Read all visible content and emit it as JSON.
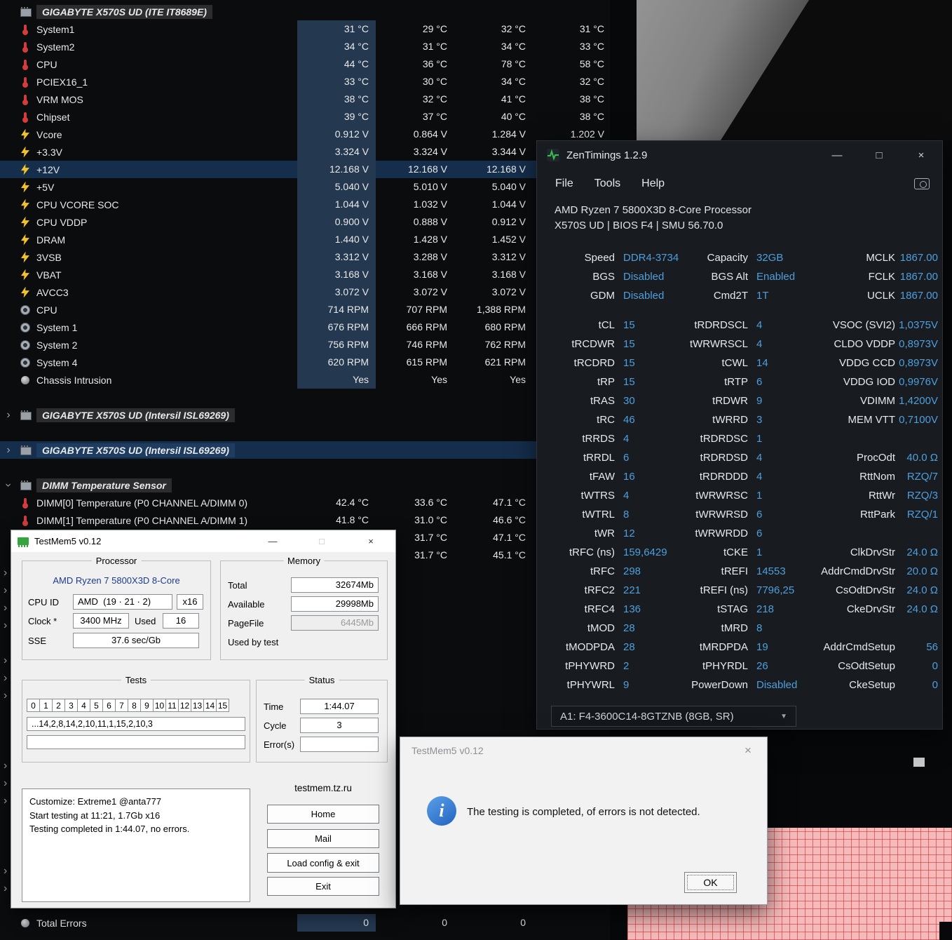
{
  "colors": {
    "zt_value_blue": "#4f9fdd",
    "sensor_highlight": "#243850",
    "selected_row": "#152e4c",
    "memory_map_pink": "#f6baba",
    "memory_map_line": "#cd3c3c",
    "testmem_cpu_name_blue": "#1b3b8f"
  },
  "icons": {
    "minimize": "—",
    "maximize": "□",
    "close": "×",
    "dropdown_arrow": "▼",
    "collapsed_arrow": "›"
  },
  "sensor_panel": {
    "rows": [
      {
        "kind": "group",
        "icon": "chip-icon",
        "label": "GIGABYTE X570S UD (ITE IT8689E)"
      },
      {
        "kind": "sensor",
        "icon": "thermometer-icon",
        "label": "System1",
        "hl": true,
        "values": [
          "31 °C",
          "29 °C",
          "32 °C",
          "31 °C"
        ]
      },
      {
        "kind": "sensor",
        "icon": "thermometer-icon",
        "label": "System2",
        "hl": true,
        "values": [
          "34 °C",
          "31 °C",
          "34 °C",
          "33 °C"
        ]
      },
      {
        "kind": "sensor",
        "icon": "thermometer-icon",
        "label": "CPU",
        "hl": true,
        "values": [
          "44 °C",
          "36 °C",
          "78 °C",
          "58 °C"
        ]
      },
      {
        "kind": "sensor",
        "icon": "thermometer-icon",
        "label": "PCIEX16_1",
        "hl": true,
        "values": [
          "33 °C",
          "30 °C",
          "34 °C",
          "32 °C"
        ]
      },
      {
        "kind": "sensor",
        "icon": "thermometer-icon",
        "label": "VRM MOS",
        "hl": true,
        "values": [
          "38 °C",
          "32 °C",
          "41 °C",
          "38 °C"
        ]
      },
      {
        "kind": "sensor",
        "icon": "thermometer-icon",
        "label": "Chipset",
        "hl": true,
        "values": [
          "39 °C",
          "37 °C",
          "40 °C",
          "38 °C"
        ]
      },
      {
        "kind": "sensor",
        "icon": "bolt-icon",
        "label": "Vcore",
        "hl": true,
        "values": [
          "0.912 V",
          "0.864 V",
          "1.284 V",
          "1.202 V"
        ]
      },
      {
        "kind": "sensor",
        "icon": "bolt-icon",
        "label": "+3.3V",
        "hl": true,
        "values": [
          "3.324 V",
          "3.324 V",
          "3.344 V"
        ]
      },
      {
        "kind": "sensor",
        "icon": "bolt-icon",
        "label": "+12V",
        "hl": true,
        "selected": true,
        "values": [
          "12.168 V",
          "12.168 V",
          "12.168 V"
        ]
      },
      {
        "kind": "sensor",
        "icon": "bolt-icon",
        "label": "+5V",
        "hl": true,
        "values": [
          "5.040 V",
          "5.010 V",
          "5.040 V"
        ]
      },
      {
        "kind": "sensor",
        "icon": "bolt-icon",
        "label": "CPU VCORE SOC",
        "hl": true,
        "values": [
          "1.044 V",
          "1.032 V",
          "1.044 V"
        ]
      },
      {
        "kind": "sensor",
        "icon": "bolt-icon",
        "label": "CPU VDDP",
        "hl": true,
        "values": [
          "0.900 V",
          "0.888 V",
          "0.912 V"
        ]
      },
      {
        "kind": "sensor",
        "icon": "bolt-icon",
        "label": "DRAM",
        "hl": true,
        "values": [
          "1.440 V",
          "1.428 V",
          "1.452 V"
        ]
      },
      {
        "kind": "sensor",
        "icon": "bolt-icon",
        "label": "3VSB",
        "hl": true,
        "values": [
          "3.312 V",
          "3.288 V",
          "3.312 V"
        ]
      },
      {
        "kind": "sensor",
        "icon": "bolt-icon",
        "label": "VBAT",
        "hl": true,
        "values": [
          "3.168 V",
          "3.168 V",
          "3.168 V"
        ]
      },
      {
        "kind": "sensor",
        "icon": "bolt-icon",
        "label": "AVCC3",
        "hl": true,
        "values": [
          "3.072 V",
          "3.072 V",
          "3.072 V"
        ]
      },
      {
        "kind": "sensor",
        "icon": "fan-icon",
        "label": "CPU",
        "hl": true,
        "values": [
          "714 RPM",
          "707 RPM",
          "1,388 RPM"
        ]
      },
      {
        "kind": "sensor",
        "icon": "fan-icon",
        "label": "System 1",
        "hl": true,
        "values": [
          "676 RPM",
          "666 RPM",
          "680 RPM"
        ]
      },
      {
        "kind": "sensor",
        "icon": "fan-icon",
        "label": "System 2",
        "hl": true,
        "values": [
          "756 RPM",
          "746 RPM",
          "762 RPM"
        ]
      },
      {
        "kind": "sensor",
        "icon": "fan-icon",
        "label": "System 4",
        "hl": true,
        "values": [
          "620 RPM",
          "615 RPM",
          "621 RPM"
        ]
      },
      {
        "kind": "sensor",
        "icon": "circle-icon",
        "label": "Chassis Intrusion",
        "hl": true,
        "values": [
          "Yes",
          "Yes",
          "Yes"
        ]
      },
      {
        "kind": "spacer"
      },
      {
        "kind": "group",
        "arrow": "right",
        "icon": "chip-icon",
        "label": "GIGABYTE X570S UD (Intersil ISL69269)"
      },
      {
        "kind": "spacer"
      },
      {
        "kind": "group",
        "arrow": "right",
        "icon": "chip-icon",
        "label": "GIGABYTE X570S UD (Intersil ISL69269)",
        "selected": true
      },
      {
        "kind": "spacer"
      },
      {
        "kind": "group",
        "arrow": "down",
        "icon": "chip-icon",
        "label": "DIMM Temperature Sensor"
      },
      {
        "kind": "sensor",
        "icon": "thermometer-icon",
        "label": "DIMM[0] Temperature (P0 CHANNEL A/DIMM 0)",
        "values": [
          "42.4 °C",
          "33.6 °C",
          "47.1 °C"
        ]
      },
      {
        "kind": "sensor",
        "icon": "thermometer-icon",
        "label": "DIMM[1] Temperature (P0 CHANNEL A/DIMM 1)",
        "values": [
          "41.8 °C",
          "31.0 °C",
          "46.6 °C"
        ]
      },
      {
        "kind": "sensor",
        "values": [
          "",
          "31.7 °C",
          "47.1 °C"
        ]
      },
      {
        "kind": "sensor",
        "values": [
          "",
          "31.7 °C",
          "45.1 °C"
        ]
      }
    ],
    "total_errors": {
      "label": "Total Errors",
      "values": [
        "0",
        "0",
        "0"
      ]
    }
  },
  "zentimings": {
    "title": "ZenTimings 1.2.9",
    "menu": [
      "File",
      "Tools",
      "Help"
    ],
    "cpu_name": "AMD Ryzen 7 5800X3D 8-Core Processor",
    "board_info": "X570S UD | BIOS F4 | SMU 56.70.0",
    "info_rows": [
      [
        "Speed",
        "DDR4-3734",
        "Capacity",
        "32GB",
        "MCLK",
        "1867.00"
      ],
      [
        "BGS",
        "Disabled",
        "BGS Alt",
        "Enabled",
        "FCLK",
        "1867.00"
      ],
      [
        "GDM",
        "Disabled",
        "Cmd2T",
        "1T",
        "UCLK",
        "1867.00"
      ]
    ],
    "timing_rows": [
      [
        "tCL",
        "15",
        "tRDRDSCL",
        "4",
        "VSOC (SVI2)",
        "1,0375V"
      ],
      [
        "tRCDWR",
        "15",
        "tWRWRSCL",
        "4",
        "CLDO VDDP",
        "0,8973V"
      ],
      [
        "tRCDRD",
        "15",
        "tCWL",
        "14",
        "VDDG CCD",
        "0,8973V"
      ],
      [
        "tRP",
        "15",
        "tRTP",
        "6",
        "VDDG IOD",
        "0,9976V"
      ],
      [
        "tRAS",
        "30",
        "tRDWR",
        "9",
        "VDIMM",
        "1,4200V"
      ],
      [
        "tRC",
        "46",
        "tWRRD",
        "3",
        "MEM VTT",
        "0,7100V"
      ],
      [
        "tRRDS",
        "4",
        "tRDRDSC",
        "1",
        "",
        ""
      ],
      [
        "tRRDL",
        "6",
        "tRDRDSD",
        "4",
        "ProcOdt",
        "40.0 Ω"
      ],
      [
        "tFAW",
        "16",
        "tRDRDDD",
        "4",
        "RttNom",
        "RZQ/7"
      ],
      [
        "tWTRS",
        "4",
        "tWRWRSC",
        "1",
        "RttWr",
        "RZQ/3"
      ],
      [
        "tWTRL",
        "8",
        "tWRWRSD",
        "6",
        "RttPark",
        "RZQ/1"
      ],
      [
        "tWR",
        "12",
        "tWRWRDD",
        "6",
        "",
        ""
      ],
      [
        "tRFC (ns)",
        "159,6429",
        "tCKE",
        "1",
        "ClkDrvStr",
        "24.0 Ω"
      ],
      [
        "tRFC",
        "298",
        "tREFI",
        "14553",
        "AddrCmdDrvStr",
        "20.0 Ω"
      ],
      [
        "tRFC2",
        "221",
        "tREFI (ns)",
        "7796,25",
        "CsOdtDrvStr",
        "24.0 Ω"
      ],
      [
        "tRFC4",
        "136",
        "tSTAG",
        "218",
        "CkeDrvStr",
        "24.0 Ω"
      ],
      [
        "tMOD",
        "28",
        "tMRD",
        "8",
        "",
        ""
      ],
      [
        "tMODPDA",
        "28",
        "tMRDPDA",
        "19",
        "AddrCmdSetup",
        "56"
      ],
      [
        "tPHYWRD",
        "2",
        "tPHYRDL",
        "26",
        "CsOdtSetup",
        "0"
      ],
      [
        "tPHYWRL",
        "9",
        "PowerDown",
        "Disabled",
        "CkeSetup",
        "0"
      ]
    ],
    "dimm_selector": "A1: F4-3600C14-8GTZNB (8GB, SR)"
  },
  "testmem5": {
    "title": "TestMem5 v0.12",
    "processor": {
      "group_label": "Processor",
      "name": "AMD Ryzen 7 5800X3D 8-Core",
      "cpu_id_label": "CPU ID",
      "cpu_vendor": "AMD",
      "cpu_id": "(19 · 21 · 2)",
      "threads": "x16",
      "clock_label": "Clock *",
      "clock": "3400 MHz",
      "used_label": "Used",
      "used": "16",
      "sse_label": "SSE",
      "sse": "37.6 sec/Gb"
    },
    "memory": {
      "group_label": "Memory",
      "rows": [
        {
          "label": "Total",
          "value": "32674Mb"
        },
        {
          "label": "Available",
          "value": "29998Mb"
        },
        {
          "label": "PageFile",
          "value": "6445Mb"
        },
        {
          "label": "Used by test",
          "value": ""
        }
      ]
    },
    "tests": {
      "group_label": "Tests",
      "numbers": [
        "0",
        "1",
        "2",
        "3",
        "4",
        "5",
        "6",
        "7",
        "8",
        "9",
        "10",
        "11",
        "12",
        "13",
        "14",
        "15"
      ],
      "sequence": "...14,2,8,14,2,10,11,1,15,2,10,3",
      "sequence2": ""
    },
    "status": {
      "group_label": "Status",
      "time_label": "Time",
      "time": "1:44.07",
      "cycle_label": "Cycle",
      "cycle": "3",
      "errors_label": "Error(s)",
      "errors": ""
    },
    "log_lines": [
      "Customize: Extreme1 @anta777",
      "Start testing at 11:21, 1.7Gb x16",
      "Testing completed in 1:44.07, no errors."
    ],
    "site": "testmem.tz.ru",
    "buttons": [
      "Home",
      "Mail",
      "Load config & exit",
      "Exit"
    ]
  },
  "dialog": {
    "title": "TestMem5 v0.12",
    "message": "The testing is completed, of errors is not detected.",
    "ok": "OK"
  }
}
